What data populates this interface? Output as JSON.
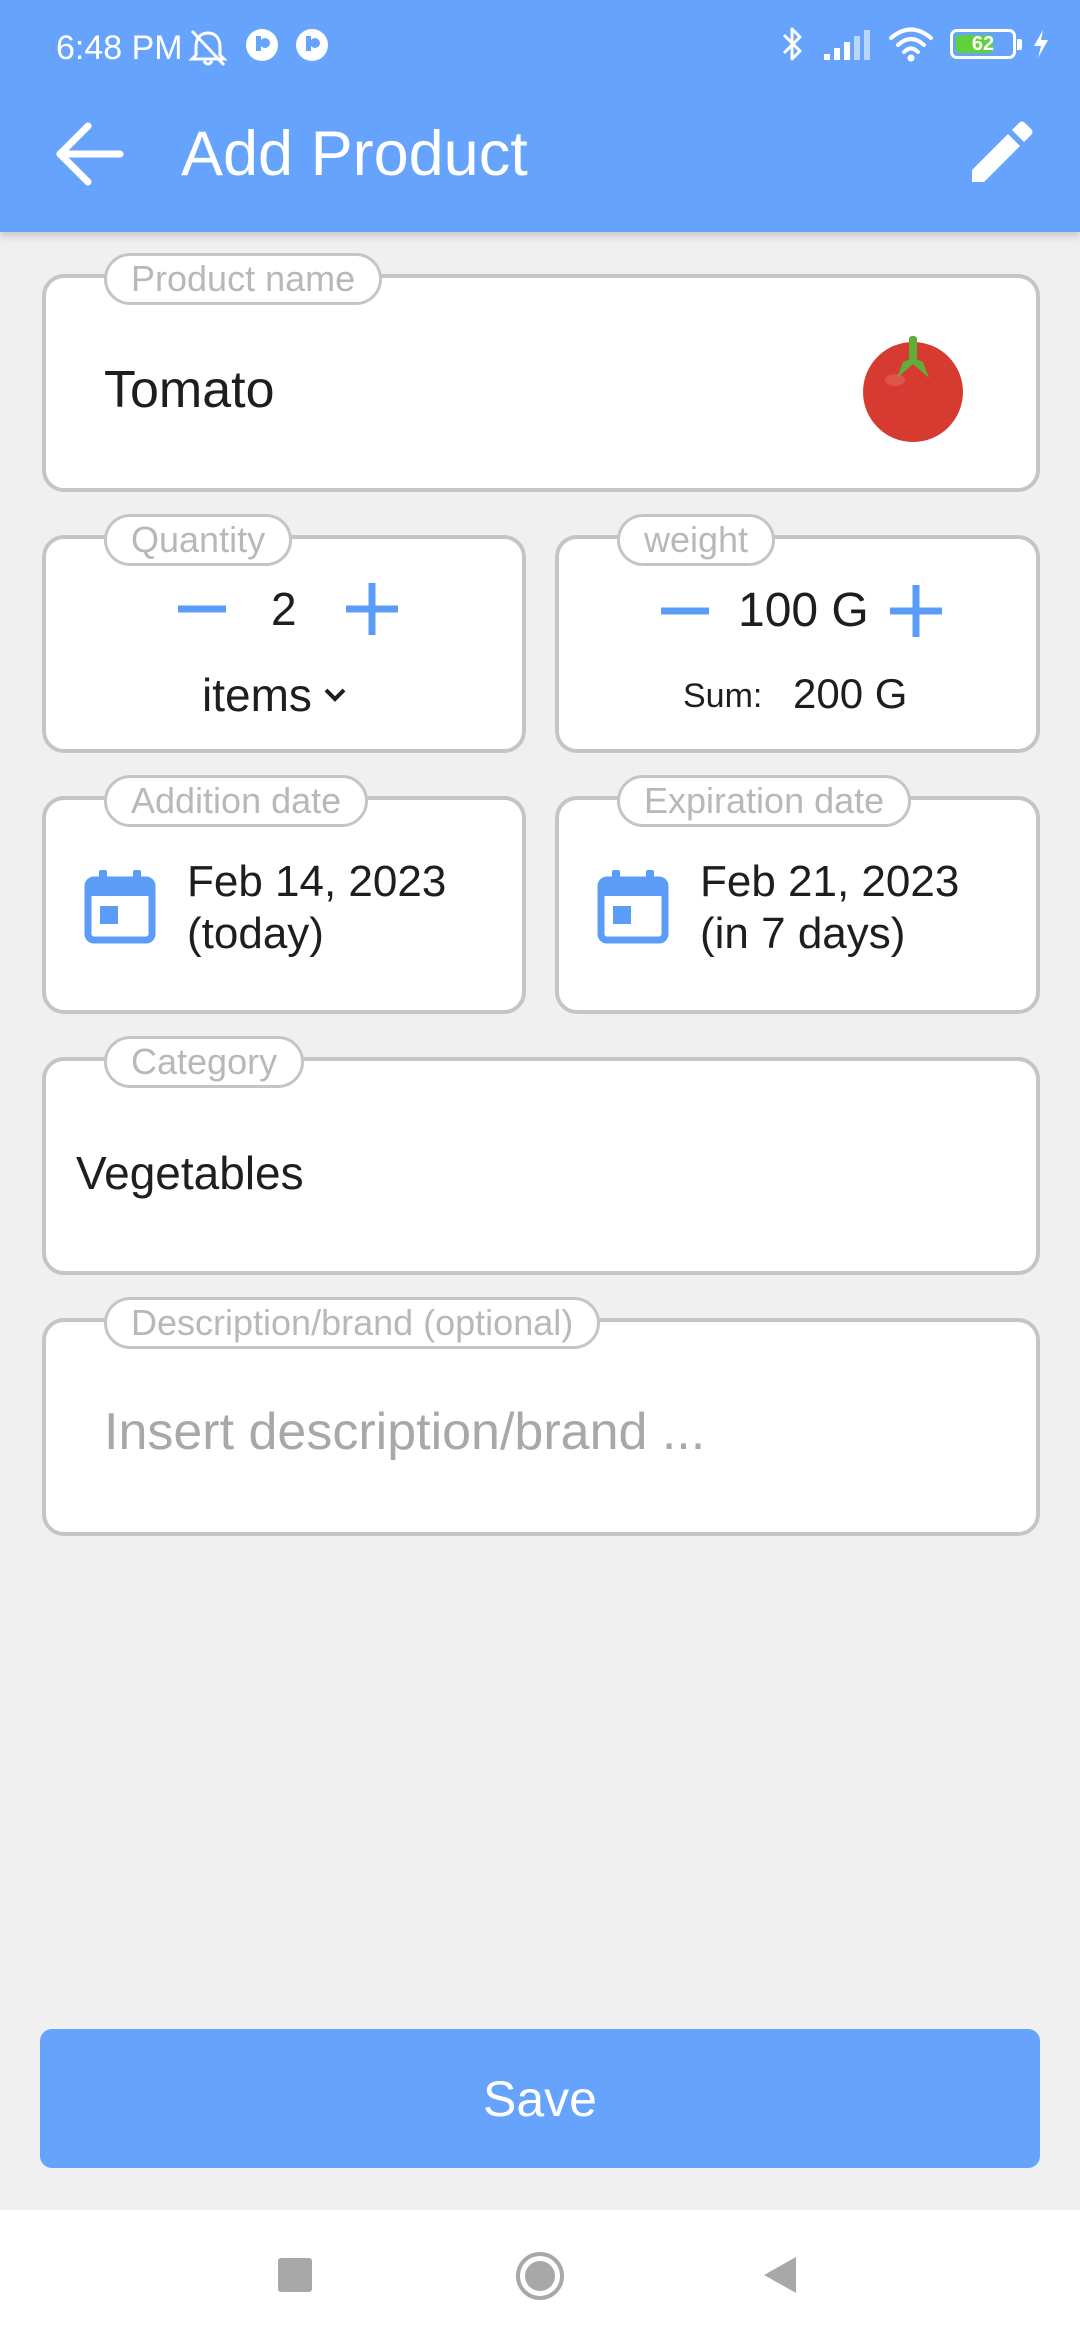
{
  "status_bar": {
    "time": "6:48 PM",
    "battery_level": "62",
    "battery_fraction": 0.62,
    "icons": [
      "alarm-off-icon",
      "app-notification-icon",
      "app-notification-icon",
      "bluetooth-icon",
      "signal-icon",
      "wifi-icon",
      "battery-icon",
      "charging-icon"
    ]
  },
  "app_bar": {
    "title": "Add Product",
    "back_icon": "arrow-left-icon",
    "edit_icon": "pencil-icon"
  },
  "product_name": {
    "label": "Product name",
    "value": "Tomato",
    "icon": "tomato-icon"
  },
  "quantity": {
    "label": "Quantity",
    "value": "2",
    "unit": "items",
    "decrement_icon": "minus-icon",
    "increment_icon": "plus-icon",
    "dropdown_icon": "chevron-down-icon"
  },
  "weight": {
    "label": "weight",
    "value": "100 G",
    "sum_label": "Sum:",
    "sum_value": "200 G"
  },
  "addition_date": {
    "label": "Addition date",
    "date": "Feb 14, 2023",
    "note": "(today)",
    "icon": "calendar-icon"
  },
  "expiration_date": {
    "label": "Expiration date",
    "date": "Feb 21, 2023",
    "note": "(in 7 days)",
    "icon": "calendar-icon"
  },
  "category": {
    "label": "Category",
    "value": "Vegetables"
  },
  "description": {
    "label": "Description/brand (optional)",
    "placeholder": "Insert description/brand ..."
  },
  "save_button": {
    "label": "Save"
  },
  "colors": {
    "accent": "#66a3fc",
    "background": "#f0f0f0",
    "border": "#c5c5c5",
    "label_text": "#b8b8b8",
    "tomato": "#d63a30",
    "leaf": "#5fae3a"
  },
  "nav_bar": {
    "icons": [
      "recents-square-icon",
      "home-circle-icon",
      "back-triangle-icon"
    ]
  }
}
